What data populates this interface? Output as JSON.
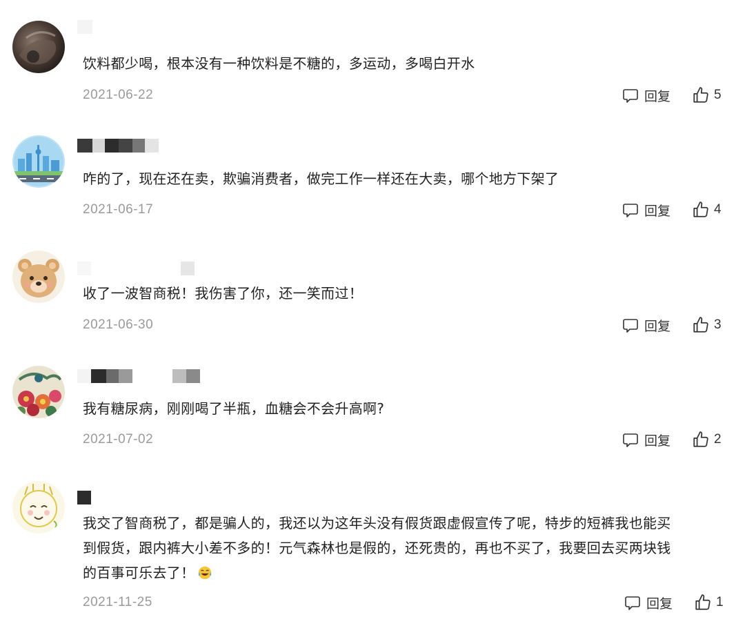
{
  "reply_label": "回复",
  "comments": [
    {
      "avatar": "dark-photo-avatar",
      "text": "饮料都少喝，根本没有一种饮料是不糖的，多运动，多喝白开水",
      "date": "2021-06-22",
      "likes": "5"
    },
    {
      "avatar": "city-skyline-avatar",
      "text": "咋的了，现在还在卖，欺骗消费者，做完工作一样还在大卖，哪个地方下架了",
      "date": "2021-06-17",
      "likes": "4"
    },
    {
      "avatar": "bear-avatar",
      "text": "收了一波智商税！我伤害了你，还一笑而过！",
      "date": "2021-06-30",
      "likes": "3"
    },
    {
      "avatar": "peacock-flowers-avatar",
      "text": "我有糖尿病，刚刚喝了半瓶，血糖会不会升高啊?",
      "date": "2021-07-02",
      "likes": "2"
    },
    {
      "avatar": "cartoon-face-avatar",
      "text_lines": [
        "我交了智商税了，都是骗人的，我还以为这年头没有假货跟虚假宣传了呢，特步的短裤我也能买",
        "到假货，跟内裤大小差不多的！元气森林也是假的，还死贵的，再也不买了，我要回去买两块钱",
        "的百事可乐去了！"
      ],
      "emoji": "laughing-tears-emoji",
      "date": "2021-11-25",
      "likes": "1"
    }
  ]
}
